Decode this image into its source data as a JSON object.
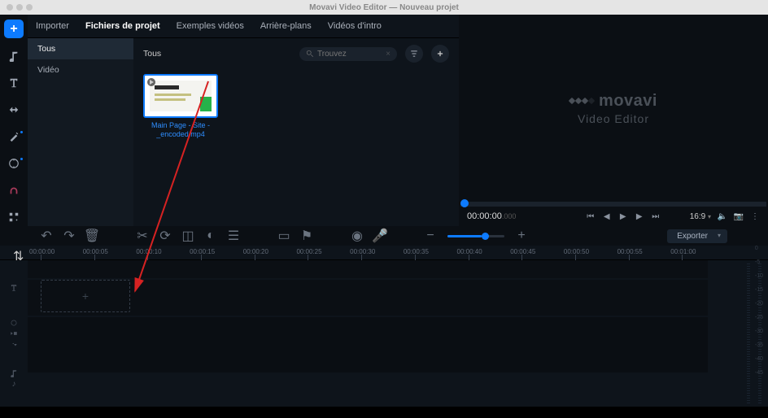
{
  "title": "Movavi Video Editor — Nouveau projet",
  "tabs": [
    "Importer",
    "Fichiers de projet",
    "Exemples vidéos",
    "Arrière-plans",
    "Vidéos d'intro"
  ],
  "active_tab": "Fichiers de projet",
  "sidelist": {
    "items": [
      "Tous",
      "Vidéo"
    ],
    "active": "Tous"
  },
  "filehdr": {
    "label": "Tous",
    "search_placeholder": "Trouvez"
  },
  "clip": {
    "name": "Main Page - Site -_encoded.mp4"
  },
  "brand": {
    "name": "movavi",
    "sub": "Video Editor"
  },
  "playback": {
    "time": "00:00:00",
    "ms": ".000",
    "aspect": "16:9"
  },
  "export_label": "Exporter",
  "ruler": [
    "00:00:00",
    "00:00:05",
    "00:00:10",
    "00:00:15",
    "00:00:20",
    "00:00:25",
    "00:00:30",
    "00:00:35",
    "00:00:40",
    "00:00:45",
    "00:00:50",
    "00:00:55",
    "00:01:00"
  ],
  "drop_symbol": "+",
  "meter_labels": [
    "0",
    "-5",
    "-10",
    "-15",
    "-20",
    "-25",
    "-30",
    "-35",
    "-40",
    "-45"
  ],
  "slider": {
    "minus": "−",
    "plus": "+"
  }
}
